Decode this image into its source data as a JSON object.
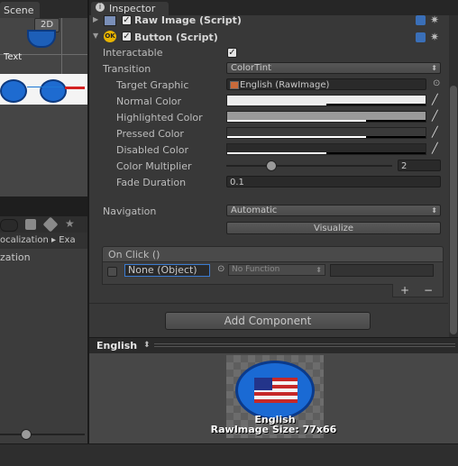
{
  "left_panel": {
    "scene_tab": "Scene",
    "mode_2d": "2D",
    "scene_text": "Text",
    "breadcrumb": "ocalization ▸ Exa",
    "list_item": "zation"
  },
  "inspector": {
    "tab_label": "Inspector",
    "raw_image_header": "Raw Image (Script)",
    "button_header": "Button (Script)",
    "button_icon_text": "OK",
    "fields": {
      "interactable_label": "Interactable",
      "transition_label": "Transition",
      "transition_value": "ColorTint",
      "target_graphic_label": "Target Graphic",
      "target_graphic_value": "English (RawImage)",
      "normal_color_label": "Normal Color",
      "highlighted_color_label": "Highlighted Color",
      "pressed_color_label": "Pressed Color",
      "disabled_color_label": "Disabled Color",
      "color_multiplier_label": "Color Multiplier",
      "color_multiplier_value": "2",
      "fade_duration_label": "Fade Duration",
      "fade_duration_value": "0.1",
      "navigation_label": "Navigation",
      "navigation_value": "Automatic",
      "visualize_label": "Visualize"
    },
    "onclick": {
      "header": "On Click ()",
      "object_value": "None (Object)",
      "function_value": "No Function",
      "add_label": "+",
      "remove_label": "−"
    },
    "add_component_label": "Add Component"
  },
  "preview": {
    "title": "English",
    "image_label": "English",
    "image_size": "RawImage Size: 77x66"
  },
  "colors": {
    "panel_bg": "#383838",
    "field_bg": "#2a2a2a",
    "accent_blue": "#1d78d6",
    "ok_icon": "#e8b400"
  }
}
